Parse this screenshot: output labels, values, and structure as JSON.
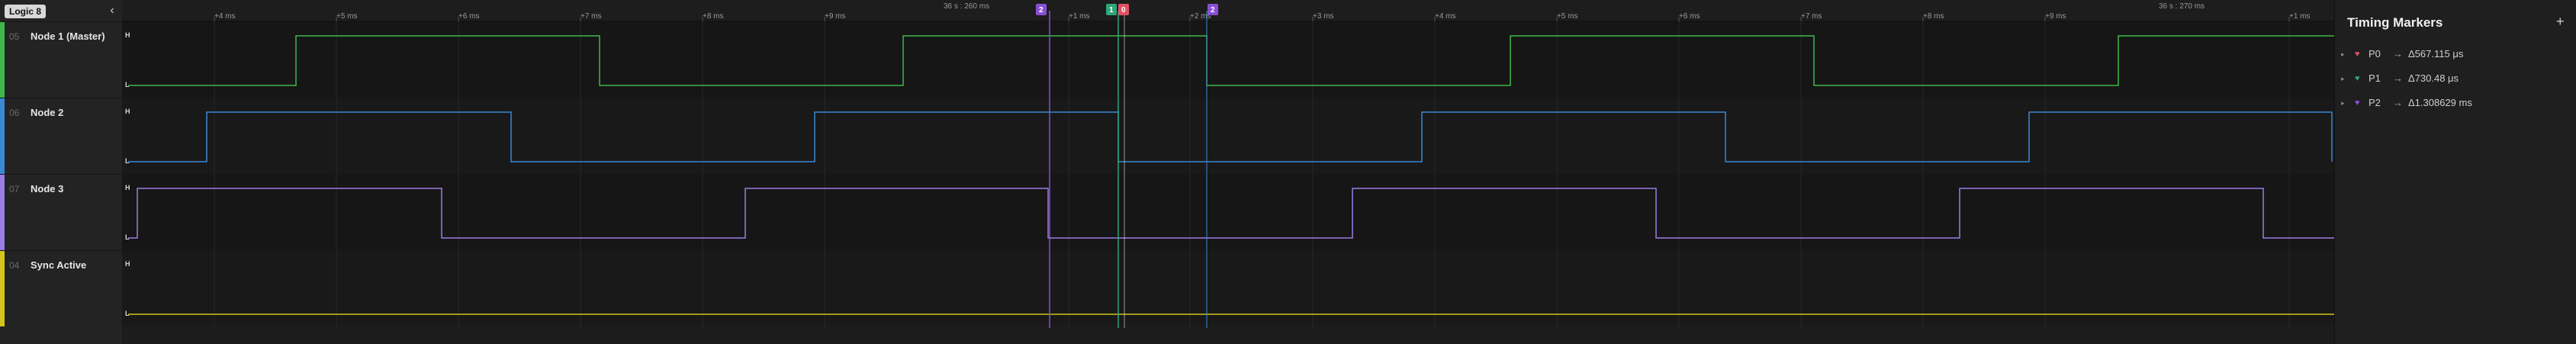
{
  "app": {
    "device_badge": "Logic 8"
  },
  "colors": {
    "green": "#3fb74a",
    "blue": "#3b88d6",
    "purple": "#9b7de6",
    "yellow": "#d4c51c",
    "marker_red": "#e05263",
    "marker_green": "#2ea67a",
    "marker_purple": "#8a4fd6"
  },
  "channels": [
    {
      "num": "05",
      "name": "Node 1 (Master)",
      "color": "#3fb74a",
      "high": "H",
      "low": "L"
    },
    {
      "num": "06",
      "name": "Node 2",
      "color": "#3b88d6",
      "high": "H",
      "low": "L"
    },
    {
      "num": "07",
      "name": "Node 3",
      "color": "#9b7de6",
      "high": "H",
      "low": "L"
    },
    {
      "num": "04",
      "name": "Sync Active",
      "color": "#d4c51c",
      "high": "H",
      "low": "L"
    }
  ],
  "ruler": {
    "group_labels": [
      "36 s : 260 ms",
      "36 s : 270 ms"
    ],
    "ticks": [
      "+4 ms",
      "+5 ms",
      "+6 ms",
      "+7 ms",
      "+8 ms",
      "+9 ms",
      "+1 ms",
      "+2 ms",
      "+3 ms",
      "+4 ms",
      "+5 ms",
      "+6 ms",
      "+7 ms",
      "+8 ms",
      "+9 ms",
      "+1 ms"
    ]
  },
  "marker_flags": [
    "2",
    "1",
    "0",
    "2"
  ],
  "markers_panel": {
    "title": "Timing Markers",
    "add_icon": "plus-icon",
    "items": [
      {
        "name": "P0",
        "value": "Δ567.115 μs",
        "color": "#e05263"
      },
      {
        "name": "P1",
        "value": "Δ730.48 μs",
        "color": "#2ea67a"
      },
      {
        "name": "P2",
        "value": "Δ1.308629 ms",
        "color": "#8a4fd6"
      }
    ]
  }
}
